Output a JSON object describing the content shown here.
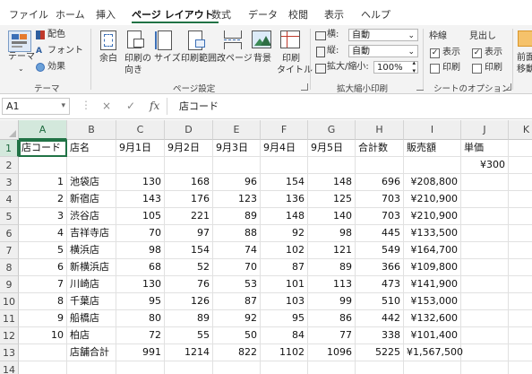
{
  "tabs": [
    {
      "label": "ファイル"
    },
    {
      "label": "ホーム"
    },
    {
      "label": "挿入"
    },
    {
      "label": "ページ レイアウト",
      "active": true
    },
    {
      "label": "数式"
    },
    {
      "label": "データ"
    },
    {
      "label": "校閲"
    },
    {
      "label": "表示"
    },
    {
      "label": "ヘルプ"
    }
  ],
  "ribbon": {
    "theme": {
      "theme_label": "テーマ",
      "colors_label": "配色",
      "fonts_label": "フォント",
      "effects_label": "効果",
      "group_label": "テーマ"
    },
    "page_setup": {
      "margins_label": "余白",
      "orientation_label_1": "印刷の",
      "orientation_label_2": "向き",
      "size_label": "サイズ",
      "print_area_label": "印刷範囲",
      "breaks_label": "改ページ",
      "background_label": "背景",
      "print_titles_label_1": "印刷",
      "print_titles_label_2": "タイトル",
      "group_label": "ページ設定"
    },
    "scale": {
      "width_label": "横:",
      "width_value": "自動",
      "height_label": "縦:",
      "height_value": "自動",
      "scale_label": "拡大/縮小:",
      "scale_value": "100%",
      "group_label": "拡大縮小印刷"
    },
    "sheet_options": {
      "gridlines_label": "枠線",
      "headings_label": "見出し",
      "view_label": "表示",
      "print_label": "印刷",
      "group_label": "シートのオプション",
      "gridlines_view_checked": true,
      "gridlines_print_checked": false,
      "headings_view_checked": true,
      "headings_print_checked": false
    },
    "arrange": {
      "bring_forward_label_1": "前面",
      "bring_forward_label_2": "移動"
    }
  },
  "formula_bar": {
    "name_box": "A1",
    "cancel_icon": "×",
    "enter_icon": "✓",
    "fx_label": "fx",
    "content": "店コード"
  },
  "sheet": {
    "columns": [
      "A",
      "B",
      "C",
      "D",
      "E",
      "F",
      "G",
      "H",
      "I",
      "J",
      "K"
    ],
    "active_cell": "A1",
    "rows": [
      {
        "n": "1",
        "cells": [
          "店コード",
          "店名",
          "9月1日",
          "9月2日",
          "9月3日",
          "9月4日",
          "9月5日",
          "合計数",
          "販売額",
          "単価",
          ""
        ]
      },
      {
        "n": "2",
        "cells": [
          "",
          "",
          "",
          "",
          "",
          "",
          "",
          "",
          "",
          "¥300",
          ""
        ]
      },
      {
        "n": "3",
        "cells": [
          "1",
          "池袋店",
          "130",
          "168",
          "96",
          "154",
          "148",
          "696",
          "¥208,800",
          "",
          ""
        ]
      },
      {
        "n": "4",
        "cells": [
          "2",
          "新宿店",
          "143",
          "176",
          "123",
          "136",
          "125",
          "703",
          "¥210,900",
          "",
          ""
        ]
      },
      {
        "n": "5",
        "cells": [
          "3",
          "渋谷店",
          "105",
          "221",
          "89",
          "148",
          "140",
          "703",
          "¥210,900",
          "",
          ""
        ]
      },
      {
        "n": "6",
        "cells": [
          "4",
          "吉祥寺店",
          "70",
          "97",
          "88",
          "92",
          "98",
          "445",
          "¥133,500",
          "",
          ""
        ]
      },
      {
        "n": "7",
        "cells": [
          "5",
          "横浜店",
          "98",
          "154",
          "74",
          "102",
          "121",
          "549",
          "¥164,700",
          "",
          ""
        ]
      },
      {
        "n": "8",
        "cells": [
          "6",
          "新横浜店",
          "68",
          "52",
          "70",
          "87",
          "89",
          "366",
          "¥109,800",
          "",
          ""
        ]
      },
      {
        "n": "9",
        "cells": [
          "7",
          "川崎店",
          "130",
          "76",
          "53",
          "101",
          "113",
          "473",
          "¥141,900",
          "",
          ""
        ]
      },
      {
        "n": "10",
        "cells": [
          "8",
          "千葉店",
          "95",
          "126",
          "87",
          "103",
          "99",
          "510",
          "¥153,000",
          "",
          ""
        ]
      },
      {
        "n": "11",
        "cells": [
          "9",
          "船橋店",
          "80",
          "89",
          "92",
          "95",
          "86",
          "442",
          "¥132,600",
          "",
          ""
        ]
      },
      {
        "n": "12",
        "cells": [
          "10",
          "柏店",
          "72",
          "55",
          "50",
          "84",
          "77",
          "338",
          "¥101,400",
          "",
          ""
        ]
      },
      {
        "n": "13",
        "cells": [
          "",
          "店舗合計",
          "991",
          "1214",
          "822",
          "1102",
          "1096",
          "5225",
          "¥1,567,500",
          "",
          ""
        ]
      },
      {
        "n": "14",
        "cells": [
          "",
          "",
          "",
          "",
          "",
          "",
          "",
          "",
          "",
          "",
          ""
        ]
      }
    ]
  }
}
